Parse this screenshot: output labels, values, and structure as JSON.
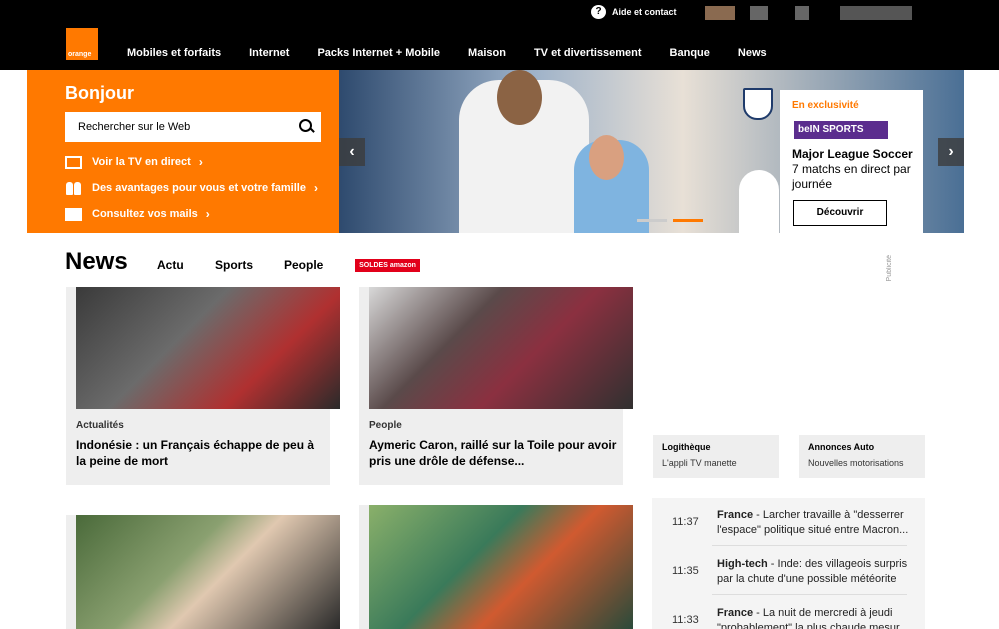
{
  "header": {
    "logo_text": "orange",
    "help_text": "Aide et contact",
    "nav": [
      "Mobiles et forfaits",
      "Internet",
      "Packs Internet + Mobile",
      "Maison",
      "TV et divertissement",
      "Banque",
      "News"
    ]
  },
  "panel": {
    "greeting": "Bonjour",
    "search_placeholder": "Rechercher sur le Web",
    "links": [
      "Voir la TV en direct",
      "Des avantages pour vous et votre famille",
      "Consultez vos mails"
    ]
  },
  "promo": {
    "exclusive": "En exclusivité",
    "brand": "beIN SPORTS",
    "title": "Major League Soccer",
    "subtitle": "7 matchs en direct par journée",
    "cta": "Découvrir"
  },
  "news": {
    "heading": "News",
    "tabs": [
      "Actu",
      "Sports",
      "People"
    ],
    "sponsor": "SOLDES amazon",
    "ad_label": "Publicité",
    "cards": [
      {
        "category": "Actualités",
        "title": "Indonésie : un Français échappe de peu à la peine de mort"
      },
      {
        "category": "People",
        "title": "Aymeric Caron, raillé sur la Toile pour avoir pris une drôle de défense..."
      }
    ]
  },
  "side": {
    "boxes": [
      {
        "title": "Logithèque",
        "text": "L'appli TV manette"
      },
      {
        "title": "Annonces Auto",
        "text": "Nouvelles motorisations"
      }
    ],
    "feed": [
      {
        "time": "11:37",
        "section": "France",
        "text": " - Larcher travaille à \"desserrer l'espace\" politique situé entre Macron..."
      },
      {
        "time": "11:35",
        "section": "High-tech",
        "text": " - Inde: des villageois surpris par la chute d'une possible météorite"
      },
      {
        "time": "11:33",
        "section": "France",
        "text": " - La nuit de mercredi à jeudi \"probablement\" la plus chaude mesur..."
      }
    ]
  },
  "colors": {
    "brand": "#ff7900",
    "topbar": "#000000",
    "sale": "#e2001a",
    "bein": "#5b2d8e"
  }
}
